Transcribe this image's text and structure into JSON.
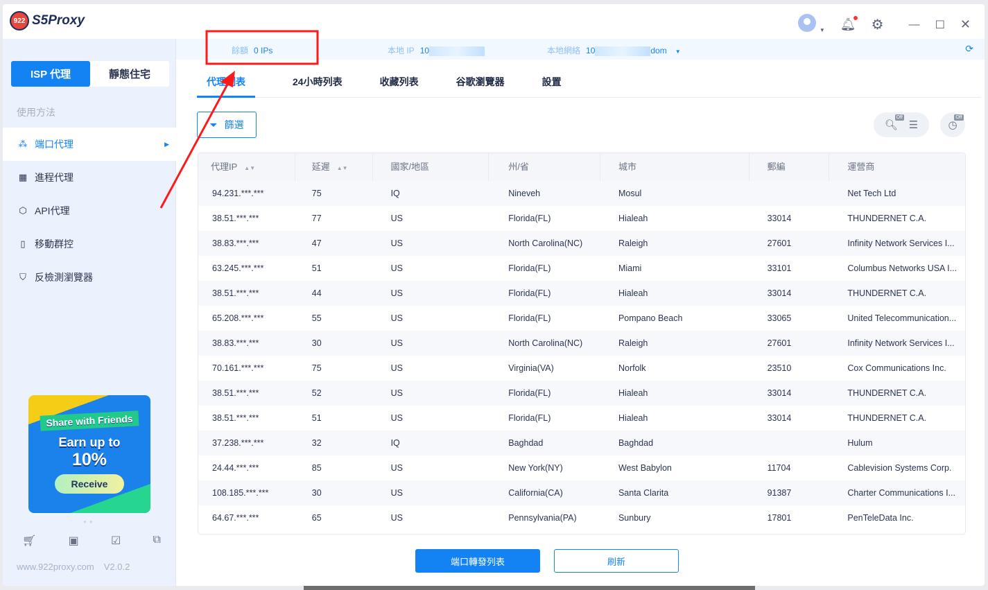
{
  "app": {
    "logo_text": "S5Proxy",
    "logo_badge": "922"
  },
  "header": {
    "icons": [
      "user-avatar-icon",
      "bell-icon",
      "gear-icon",
      "minimize-icon",
      "maximize-icon",
      "close-icon"
    ]
  },
  "sidebar": {
    "segments": [
      {
        "label": "ISP 代理",
        "active": true
      },
      {
        "label": "靜態住宅",
        "active": false
      }
    ],
    "howto": "使用方法",
    "items": [
      {
        "label": "端口代理",
        "icon": "nodes-icon",
        "active": true
      },
      {
        "label": "進程代理",
        "icon": "grid-icon"
      },
      {
        "label": "API代理",
        "icon": "cube-icon"
      },
      {
        "label": "移動群控",
        "icon": "phone-icon"
      },
      {
        "label": "反檢測瀏覽器",
        "icon": "shield-icon"
      }
    ],
    "banner": {
      "line1": "Share with Friends",
      "line2": "Earn up to",
      "line3": "10%",
      "button": "Receive"
    },
    "footer_icons": [
      "cart-icon",
      "book-icon",
      "checklist-icon",
      "api-doc-icon"
    ],
    "website": "www.922proxy.com",
    "version": "V2.0.2"
  },
  "infobar": {
    "balance_label": "餘額",
    "balance_value": "0 IPs",
    "local_ip_label": "本地 IP",
    "local_ip_value": "10",
    "local_net_label": "本地網絡",
    "local_net_value_start": "10",
    "local_net_value_end": "dom"
  },
  "tabs": [
    "代理列表",
    "24小時列表",
    "收藏列表",
    "谷歌瀏覽器",
    "設置"
  ],
  "filter_label": "篩選",
  "toolbar_badges": "Off",
  "table": {
    "columns": [
      "代理IP",
      "延遲",
      "國家/地區",
      "州/省",
      "城市",
      "郵編",
      "運營商"
    ],
    "rows": [
      [
        "94.231.***.***",
        "75",
        "IQ",
        "Nineveh",
        "Mosul",
        "",
        "Net Tech Ltd"
      ],
      [
        "38.51.***.***",
        "77",
        "US",
        "Florida(FL)",
        "Hialeah",
        "33014",
        "THUNDERNET C.A."
      ],
      [
        "38.83.***.***",
        "47",
        "US",
        "North Carolina(NC)",
        "Raleigh",
        "27601",
        "Infinity Network Services I..."
      ],
      [
        "63.245.***.***",
        "51",
        "US",
        "Florida(FL)",
        "Miami",
        "33101",
        "Columbus Networks USA I..."
      ],
      [
        "38.51.***.***",
        "44",
        "US",
        "Florida(FL)",
        "Hialeah",
        "33014",
        "THUNDERNET C.A."
      ],
      [
        "65.208.***.***",
        "55",
        "US",
        "Florida(FL)",
        "Pompano Beach",
        "33065",
        "United Telecommunication..."
      ],
      [
        "38.83.***.***",
        "30",
        "US",
        "North Carolina(NC)",
        "Raleigh",
        "27601",
        "Infinity Network Services I..."
      ],
      [
        "70.161.***.***",
        "75",
        "US",
        "Virginia(VA)",
        "Norfolk",
        "23510",
        "Cox Communications Inc."
      ],
      [
        "38.51.***.***",
        "52",
        "US",
        "Florida(FL)",
        "Hialeah",
        "33014",
        "THUNDERNET C.A."
      ],
      [
        "38.51.***.***",
        "51",
        "US",
        "Florida(FL)",
        "Hialeah",
        "33014",
        "THUNDERNET C.A."
      ],
      [
        "37.238.***.***",
        "32",
        "IQ",
        "Baghdad",
        "Baghdad",
        "",
        "Hulum"
      ],
      [
        "24.44.***.***",
        "85",
        "US",
        "New York(NY)",
        "West Babylon",
        "11704",
        "Cablevision Systems Corp."
      ],
      [
        "108.185.***.***",
        "30",
        "US",
        "California(CA)",
        "Santa Clarita",
        "91387",
        "Charter Communications I..."
      ],
      [
        "64.67.***.***",
        "65",
        "US",
        "Pennsylvania(PA)",
        "Sunbury",
        "17801",
        "PenTeleData Inc."
      ]
    ]
  },
  "buttons": {
    "forward_list": "端口轉發列表",
    "refresh": "刷新"
  },
  "colors": {
    "accent": "#1383f3",
    "annotation": "#ff1a1a"
  }
}
